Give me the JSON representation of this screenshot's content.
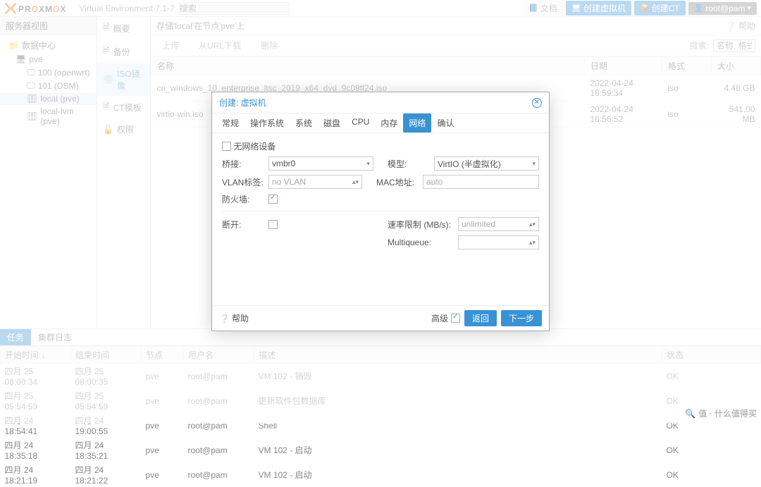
{
  "header": {
    "brand_prefix": "PR",
    "brand_mid": "O",
    "brand_suffix": "XM",
    "brand_mid2": "O",
    "brand_suffix2": "X",
    "version": "Virtual Environment 7.1-7",
    "search_placeholder": "搜索",
    "doc": "文档",
    "create_vm": "创建虚拟机",
    "create_ct": "创建CT",
    "user": "root@pam"
  },
  "left": {
    "title": "服务器视图",
    "dc": "数据中心",
    "pve": "pve",
    "n100": "100 (openwrt)",
    "n101": "101 (DSM)",
    "local": "local (pve)",
    "local_lvm": "local-lvm (pve)"
  },
  "mid_tabs": {
    "summary": "概要",
    "backup": "备份",
    "iso": "ISO镜像",
    "ct": "CT模板",
    "perm": "权限"
  },
  "content": {
    "breadcrumb_prefix": "存储'local'在节点'pve'上",
    "help": "帮助",
    "tb_upload": "上传",
    "tb_url": "从URL下载",
    "tb_delete": "删除",
    "search_label": "搜索:",
    "search_ph": "名称, 格式",
    "cols": {
      "name": "名称",
      "date": "日期",
      "fmt": "格式",
      "size": "大小"
    },
    "rows": [
      {
        "name": "cn_windows_10_enterprise_ltsc_2019_x64_dvd_9c09ff24.iso",
        "date": "2022-04-24 18:59:34",
        "fmt": "iso",
        "size": "4.48 GB"
      },
      {
        "name": "virtio-win.iso",
        "date": "2022-04-24 18:56:52",
        "fmt": "iso",
        "size": "541.00 MB"
      }
    ]
  },
  "bottom": {
    "tab_task": "任务",
    "tab_log": "集群日志",
    "cols": {
      "start": "开始时间 ↓",
      "end": "结束时间",
      "node": "节点",
      "user": "用户名",
      "desc": "描述",
      "status": "状态"
    },
    "rows": [
      {
        "start": "四月 25 08:00:34",
        "end": "四月 25 08:00:35",
        "node": "pve",
        "user": "root@pam",
        "desc": "VM 102 - 销毁",
        "status": "OK"
      },
      {
        "start": "四月 25 05:54:59",
        "end": "四月 25 05:54:59",
        "node": "pve",
        "user": "root@pam",
        "desc": "更新软件包数据库",
        "status": "OK"
      },
      {
        "start": "四月 24 18:54:41",
        "end": "四月 24 19:00:55",
        "node": "pve",
        "user": "root@pam",
        "desc": "Shell",
        "status": "OK"
      },
      {
        "start": "四月 24 18:35:18",
        "end": "四月 24 18:35:21",
        "node": "pve",
        "user": "root@pam",
        "desc": "VM 102 - 启动",
        "status": "OK"
      },
      {
        "start": "四月 24 18:21:19",
        "end": "四月 24 18:21:22",
        "node": "pve",
        "user": "root@pam",
        "desc": "VM 102 - 启动",
        "status": "OK"
      }
    ]
  },
  "modal": {
    "title": "创建: 虚拟机",
    "tabs": {
      "general": "常规",
      "os": "操作系统",
      "system": "系统",
      "disk": "磁盘",
      "cpu": "CPU",
      "memory": "内存",
      "network": "网络",
      "confirm": "确认"
    },
    "form": {
      "no_net": "无网络设备",
      "bridge": "桥接:",
      "bridge_val": "vmbr0",
      "vlan": "VLAN标签:",
      "vlan_val": "no VLAN",
      "firewall": "防火墙:",
      "model": "模型:",
      "model_val": "VirtIO (半虚拟化)",
      "mac": "MAC地址:",
      "mac_val": "auto",
      "disconnect": "断开:",
      "rate": "速率限制 (MB/s):",
      "rate_val": "unlimited",
      "mq": "Multiqueue:",
      "mq_val": ""
    },
    "footer": {
      "help": "帮助",
      "advanced": "高级",
      "back": "返回",
      "next": "下一步"
    }
  },
  "watermark": "值 · 什么值得买"
}
